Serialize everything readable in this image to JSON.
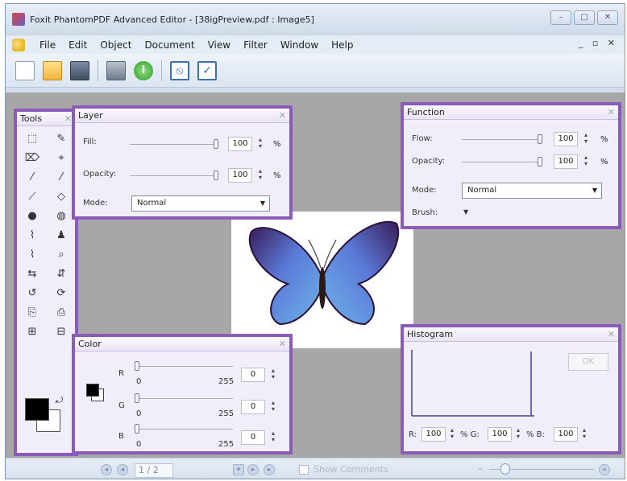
{
  "window": {
    "title": "Foxit PhantomPDF Advanced Editor - [38igPreview.pdf : Image5]",
    "controls": [
      "–",
      "□",
      "✕"
    ]
  },
  "menu": {
    "items": [
      "File",
      "Edit",
      "Object",
      "Document",
      "View",
      "Filter",
      "Window",
      "Help"
    ],
    "mdi_controls": "_ ▫ ✕"
  },
  "toolbar": {
    "buttons": [
      "new-document",
      "open-folder",
      "save",
      "print",
      "info",
      "cancel",
      "apply"
    ]
  },
  "tools_panel": {
    "title": "Tools",
    "close": "✕",
    "tools": [
      "⬚",
      "✎",
      "⌦",
      "⌖",
      "⁄",
      "⁄",
      "⟋",
      "◇",
      "●",
      "◍",
      "⌇",
      "♟",
      "⌇",
      "⌕",
      "⇆",
      "⇵",
      "↺",
      "⟳",
      "⎘",
      "⎙",
      "⊞",
      "⊟"
    ]
  },
  "layer_panel": {
    "title": "Layer",
    "close": "✕",
    "fill_label": "Fill:",
    "fill_value": "100",
    "fill_unit": "%",
    "fill_level": 1.0,
    "opacity_label": "Opacity:",
    "opacity_value": "100",
    "opacity_unit": "%",
    "opacity_level": 1.0,
    "mode_label": "Mode:",
    "mode_value": "Normal"
  },
  "function_panel": {
    "title": "Function",
    "close": "✕",
    "flow_label": "Flow:",
    "flow_value": "100",
    "flow_unit": "%",
    "flow_level": 1.0,
    "opacity_label": "Opacity:",
    "opacity_value": "100",
    "opacity_unit": "%",
    "opacity_level": 1.0,
    "mode_label": "Mode:",
    "mode_value": "Normal",
    "brush_label": "Brush:"
  },
  "color_panel": {
    "title": "Color",
    "close": "✕",
    "channels": [
      {
        "label": "R",
        "min": "0",
        "max": "255",
        "value": "0"
      },
      {
        "label": "G",
        "min": "0",
        "max": "255",
        "value": "0"
      },
      {
        "label": "B",
        "min": "0",
        "max": "255",
        "value": "0"
      }
    ]
  },
  "histogram_panel": {
    "title": "Histogram",
    "close": "✕",
    "ok_label": "OK",
    "r_label": "R:",
    "r_value": "100",
    "g_label": "% G:",
    "g_value": "100",
    "b_label": "% B:",
    "b_value": "100"
  },
  "statusbar": {
    "page_display": "1 / 2",
    "show_comments": "Show Comments"
  },
  "colors": {
    "panel_border": "#8a5bb8",
    "workspace": "#a7a7a7"
  }
}
